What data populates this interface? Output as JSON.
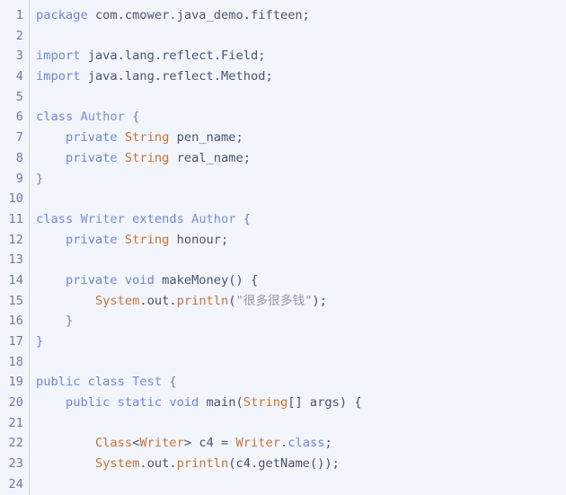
{
  "editor": {
    "language": "java",
    "background_color": "#f2f5fc",
    "gutter_divider_color": "#cfd6e4",
    "line_number_color": "#6d7d9e",
    "colors": {
      "keyword": "#7186d6",
      "type": "#c7743a",
      "identifier": "#49536f",
      "string": "#9b94a9",
      "class_name": "#7b8fd8",
      "punctuation": "#6f7fae"
    },
    "first_visible_line": 1,
    "last_visible_line": 24,
    "total_visible_lines": 24
  },
  "lines": [
    {
      "number": "1",
      "tokens": [
        {
          "t": "package ",
          "c": "kw"
        },
        {
          "t": "com.cmower.java_demo.fifteen;",
          "c": "pkg"
        }
      ]
    },
    {
      "number": "2",
      "tokens": []
    },
    {
      "number": "3",
      "tokens": [
        {
          "t": "import ",
          "c": "kw"
        },
        {
          "t": "java.lang.reflect.Field;",
          "c": "pkg"
        }
      ]
    },
    {
      "number": "4",
      "tokens": [
        {
          "t": "import ",
          "c": "kw"
        },
        {
          "t": "java.lang.reflect.Method;",
          "c": "pkg"
        }
      ]
    },
    {
      "number": "5",
      "tokens": []
    },
    {
      "number": "6",
      "tokens": [
        {
          "t": "class ",
          "c": "kw"
        },
        {
          "t": "Author",
          "c": "cls"
        },
        {
          "t": " {",
          "c": "punc"
        }
      ]
    },
    {
      "number": "7",
      "tokens": [
        {
          "t": "    ",
          "c": "plain"
        },
        {
          "t": "private ",
          "c": "kw"
        },
        {
          "t": "String",
          "c": "type"
        },
        {
          "t": " pen_name;",
          "c": "plain"
        }
      ]
    },
    {
      "number": "8",
      "tokens": [
        {
          "t": "    ",
          "c": "plain"
        },
        {
          "t": "private ",
          "c": "kw"
        },
        {
          "t": "String",
          "c": "type"
        },
        {
          "t": " real_name;",
          "c": "plain"
        }
      ]
    },
    {
      "number": "9",
      "tokens": [
        {
          "t": "}",
          "c": "punc"
        }
      ]
    },
    {
      "number": "10",
      "tokens": []
    },
    {
      "number": "11",
      "tokens": [
        {
          "t": "class ",
          "c": "kw"
        },
        {
          "t": "Writer",
          "c": "cls"
        },
        {
          "t": " extends ",
          "c": "kw"
        },
        {
          "t": "Author",
          "c": "cls"
        },
        {
          "t": " {",
          "c": "punc"
        }
      ]
    },
    {
      "number": "12",
      "tokens": [
        {
          "t": "    ",
          "c": "plain"
        },
        {
          "t": "private ",
          "c": "kw"
        },
        {
          "t": "String",
          "c": "type"
        },
        {
          "t": " honour;",
          "c": "plain"
        }
      ]
    },
    {
      "number": "13",
      "tokens": []
    },
    {
      "number": "14",
      "tokens": [
        {
          "t": "    ",
          "c": "plain"
        },
        {
          "t": "private void ",
          "c": "kw"
        },
        {
          "t": "makeMoney() {",
          "c": "plain"
        }
      ]
    },
    {
      "number": "15",
      "tokens": [
        {
          "t": "        ",
          "c": "plain"
        },
        {
          "t": "System",
          "c": "type"
        },
        {
          "t": ".out.",
          "c": "plain"
        },
        {
          "t": "println",
          "c": "type"
        },
        {
          "t": "(",
          "c": "plain"
        },
        {
          "t": "\"很多很多钱\"",
          "c": "str"
        },
        {
          "t": ");",
          "c": "plain"
        }
      ]
    },
    {
      "number": "16",
      "tokens": [
        {
          "t": "    }",
          "c": "punc"
        }
      ]
    },
    {
      "number": "17",
      "tokens": [
        {
          "t": "}",
          "c": "punc"
        }
      ]
    },
    {
      "number": "18",
      "tokens": []
    },
    {
      "number": "19",
      "tokens": [
        {
          "t": "public class ",
          "c": "kw"
        },
        {
          "t": "Test",
          "c": "cls"
        },
        {
          "t": " {",
          "c": "punc"
        }
      ]
    },
    {
      "number": "20",
      "tokens": [
        {
          "t": "    ",
          "c": "plain"
        },
        {
          "t": "public static void ",
          "c": "kw"
        },
        {
          "t": "main(",
          "c": "plain"
        },
        {
          "t": "String",
          "c": "type"
        },
        {
          "t": "[] args) {",
          "c": "plain"
        }
      ]
    },
    {
      "number": "21",
      "tokens": []
    },
    {
      "number": "22",
      "tokens": [
        {
          "t": "        ",
          "c": "plain"
        },
        {
          "t": "Class",
          "c": "type"
        },
        {
          "t": "<",
          "c": "plain"
        },
        {
          "t": "Writer",
          "c": "type"
        },
        {
          "t": "> c4 = ",
          "c": "plain"
        },
        {
          "t": "Writer",
          "c": "type"
        },
        {
          "t": ".",
          "c": "plain"
        },
        {
          "t": "class",
          "c": "kw"
        },
        {
          "t": ";",
          "c": "plain"
        }
      ]
    },
    {
      "number": "23",
      "tokens": [
        {
          "t": "        ",
          "c": "plain"
        },
        {
          "t": "System",
          "c": "type"
        },
        {
          "t": ".out.",
          "c": "plain"
        },
        {
          "t": "println",
          "c": "type"
        },
        {
          "t": "(c4.getName());",
          "c": "plain"
        }
      ]
    },
    {
      "number": "24",
      "tokens": []
    }
  ]
}
